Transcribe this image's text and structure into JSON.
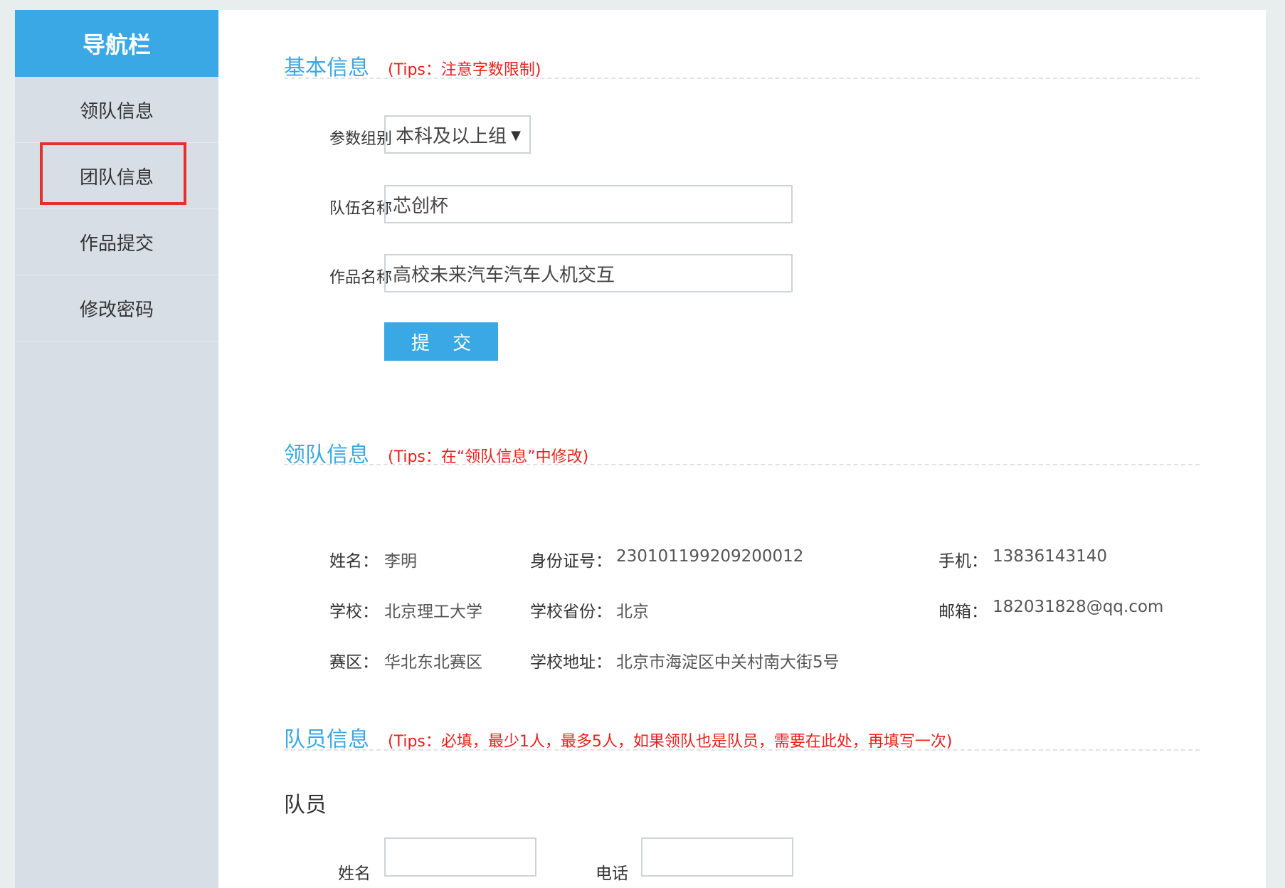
{
  "sidebar": {
    "title": "导航栏",
    "items": [
      {
        "label": "领队信息"
      },
      {
        "label": "团队信息"
      },
      {
        "label": "作品提交"
      },
      {
        "label": "修改密码"
      }
    ]
  },
  "basic": {
    "title": "基本信息",
    "tip": "(Tips：注意字数限制)",
    "group_label": "参数组别",
    "group_value": "本科及以上组",
    "team_label": "队伍名称",
    "team_value": "芯创杯",
    "work_label": "作品名称",
    "work_value": "高校未来汽车汽车人机交互",
    "submit_label": "提 交"
  },
  "leader": {
    "title": "领队信息",
    "tip": "(Tips：在“领队信息”中修改)",
    "name_label": "姓名：",
    "name_value": "李明",
    "id_label": "身份证号：",
    "id_value": "230101199209200012",
    "phone_label": "手机：",
    "phone_value": "13836143140",
    "school_label": "学校：",
    "school_value": "北京理工大学",
    "province_label": "学校省份：",
    "province_value": "北京",
    "email_label": "邮箱：",
    "email_value": "182031828@qq.com",
    "region_label": "赛区：",
    "region_value": "华北东北赛区",
    "address_label": "学校地址：",
    "address_value": "北京市海淀区中关村南大街5号"
  },
  "members": {
    "title": "队员信息",
    "tip": "(Tips：必填，最少1人，最多5人，如果领队也是队员，需要在此处，再填写一次)",
    "subtitle": "队员",
    "name_label": "姓名",
    "phone_label": "电话"
  },
  "colors": {
    "accent": "#3aa8e4",
    "tip": "#e8211c",
    "highlight_box": "#e5302d"
  }
}
